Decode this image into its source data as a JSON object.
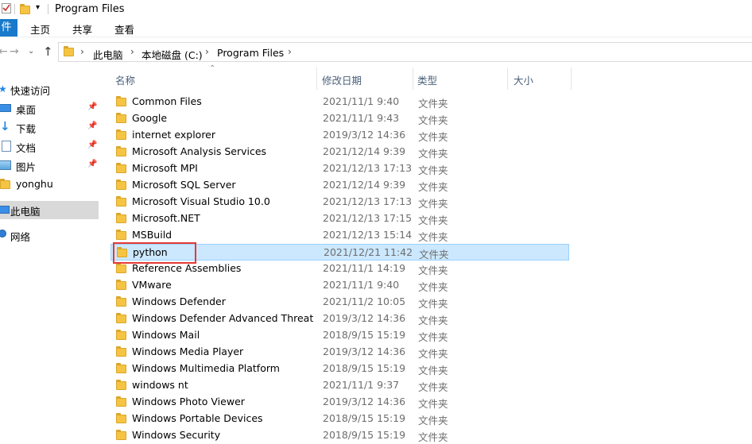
{
  "window": {
    "title": "Program Files"
  },
  "ribbon": {
    "file": "件",
    "tabs": [
      "主页",
      "共享",
      "查看"
    ]
  },
  "address": {
    "crumbs": [
      "此电脑",
      "本地磁盘 (C:)",
      "Program Files"
    ]
  },
  "nav": {
    "items": [
      {
        "label": "快速访问",
        "icon": "star-icon",
        "pinned": false
      },
      {
        "label": "桌面",
        "icon": "desktop-icon",
        "pinned": true
      },
      {
        "label": "下载",
        "icon": "download-icon",
        "pinned": true
      },
      {
        "label": "文档",
        "icon": "document-icon",
        "pinned": true
      },
      {
        "label": "图片",
        "icon": "picture-icon",
        "pinned": true
      },
      {
        "label": "yonghu",
        "icon": "folder-icon",
        "pinned": false
      },
      {
        "label": "此电脑",
        "icon": "computer-icon",
        "pinned": false,
        "selected": true
      },
      {
        "label": "网络",
        "icon": "network-icon",
        "pinned": false
      }
    ]
  },
  "columns": {
    "name": "名称",
    "date": "修改日期",
    "type": "类型",
    "size": "大小"
  },
  "files": [
    {
      "name": "Common Files",
      "date": "2021/11/1 9:40",
      "type": "文件夹"
    },
    {
      "name": "Google",
      "date": "2021/11/1 9:43",
      "type": "文件夹"
    },
    {
      "name": "internet explorer",
      "date": "2019/3/12 14:36",
      "type": "文件夹"
    },
    {
      "name": "Microsoft Analysis Services",
      "date": "2021/12/14 9:39",
      "type": "文件夹"
    },
    {
      "name": "Microsoft MPI",
      "date": "2021/12/13 17:13",
      "type": "文件夹"
    },
    {
      "name": "Microsoft SQL Server",
      "date": "2021/12/14 9:39",
      "type": "文件夹"
    },
    {
      "name": "Microsoft Visual Studio 10.0",
      "date": "2021/12/13 17:13",
      "type": "文件夹"
    },
    {
      "name": "Microsoft.NET",
      "date": "2021/12/13 17:15",
      "type": "文件夹"
    },
    {
      "name": "MSBuild",
      "date": "2021/12/13 15:14",
      "type": "文件夹"
    },
    {
      "name": "python",
      "date": "2021/12/21 11:42",
      "type": "文件夹",
      "selected": true
    },
    {
      "name": "Reference Assemblies",
      "date": "2021/11/1 14:19",
      "type": "文件夹"
    },
    {
      "name": "VMware",
      "date": "2021/11/1 9:40",
      "type": "文件夹"
    },
    {
      "name": "Windows Defender",
      "date": "2021/11/2 10:05",
      "type": "文件夹"
    },
    {
      "name": "Windows Defender Advanced Threat ...",
      "date": "2019/3/12 14:36",
      "type": "文件夹"
    },
    {
      "name": "Windows Mail",
      "date": "2018/9/15 15:19",
      "type": "文件夹"
    },
    {
      "name": "Windows Media Player",
      "date": "2019/3/12 14:36",
      "type": "文件夹"
    },
    {
      "name": "Windows Multimedia Platform",
      "date": "2018/9/15 15:19",
      "type": "文件夹"
    },
    {
      "name": "windows nt",
      "date": "2021/11/1 9:37",
      "type": "文件夹"
    },
    {
      "name": "Windows Photo Viewer",
      "date": "2019/3/12 14:36",
      "type": "文件夹"
    },
    {
      "name": "Windows Portable Devices",
      "date": "2018/9/15 15:19",
      "type": "文件夹"
    },
    {
      "name": "Windows Security",
      "date": "2018/9/15 15:19",
      "type": "文件夹"
    }
  ],
  "colors": {
    "accent": "#1979ca",
    "selection": "#cce8ff",
    "selection_border": "#99d1ff",
    "folder": "#f5c443",
    "highlight": "#e53935"
  }
}
